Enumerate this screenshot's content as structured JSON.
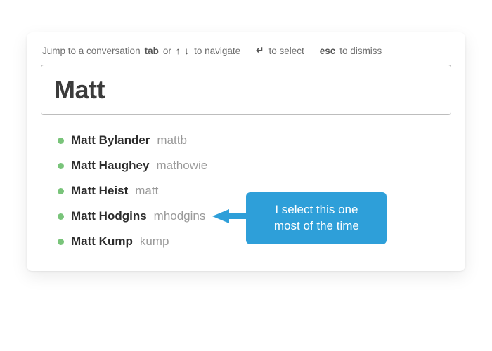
{
  "hints": {
    "lead": "Jump to a conversation",
    "tab": "tab",
    "or": "or",
    "navigate": "to navigate",
    "select": "to select",
    "esc": "esc",
    "dismiss": "to dismiss"
  },
  "search": {
    "value": "Matt"
  },
  "results": [
    {
      "name": "Matt Bylander",
      "handle": "mattb"
    },
    {
      "name": "Matt Haughey",
      "handle": "mathowie"
    },
    {
      "name": "Matt Heist",
      "handle": "matt"
    },
    {
      "name": "Matt Hodgins",
      "handle": "mhodgins"
    },
    {
      "name": "Matt Kump",
      "handle": "kump"
    }
  ],
  "callout": {
    "line1": "I select this one",
    "line2": "most of the time",
    "target_index": 3
  },
  "colors": {
    "presence": "#79c47a",
    "callout": "#2e9fd9"
  }
}
